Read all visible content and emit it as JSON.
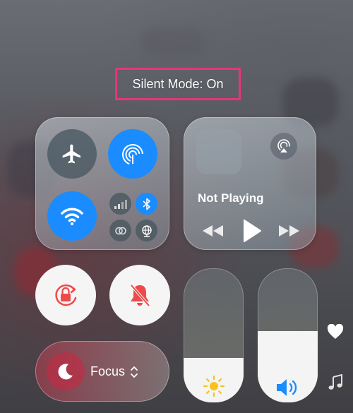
{
  "status": {
    "silent_mode": "Silent Mode: On"
  },
  "connectivity": {
    "airplane_icon": "airplane-icon",
    "airdrop_icon": "airdrop-icon",
    "wifi_icon": "wifi-icon",
    "cellular_icon": "cellular-icon",
    "bluetooth_icon": "bluetooth-icon",
    "link_icon": "link-icon",
    "vpn_icon": "globe-icon",
    "airdrop_on": true,
    "wifi_on": true,
    "bluetooth_on": true
  },
  "media": {
    "now_playing": "Not Playing",
    "airplay_icon": "airplay-icon",
    "rewind_icon": "rewind-icon",
    "play_icon": "play-icon",
    "forward_icon": "fast-forward-icon"
  },
  "toggles": {
    "orientation_lock_icon": "orientation-lock-icon",
    "silent_icon": "bell-slash-icon"
  },
  "focus": {
    "label": "Focus",
    "icon": "moon-icon",
    "chevron_icon": "chevron-updown-icon"
  },
  "sliders": {
    "brightness": {
      "level": 0.33,
      "icon": "sun-icon"
    },
    "volume": {
      "level": 0.53,
      "icon": "speaker-icon"
    }
  },
  "side_icons": {
    "heart_icon": "heart-icon",
    "music_icon": "music-note-icon"
  },
  "colors": {
    "accent_blue": "#1a8cff",
    "highlight_pink": "#e8347a",
    "silent_red": "#ef4a4a"
  }
}
